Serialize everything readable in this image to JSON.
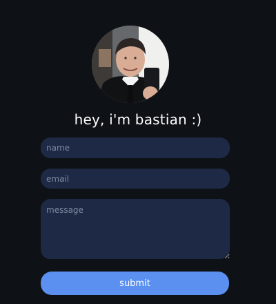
{
  "profile": {
    "greeting": "hey, i'm bastian :)"
  },
  "form": {
    "name_placeholder": "name",
    "email_placeholder": "email",
    "message_placeholder": "message",
    "submit_label": "submit"
  },
  "colors": {
    "background": "#0e1116",
    "field_background": "#1e2a45",
    "button": "#5b8ff0"
  }
}
